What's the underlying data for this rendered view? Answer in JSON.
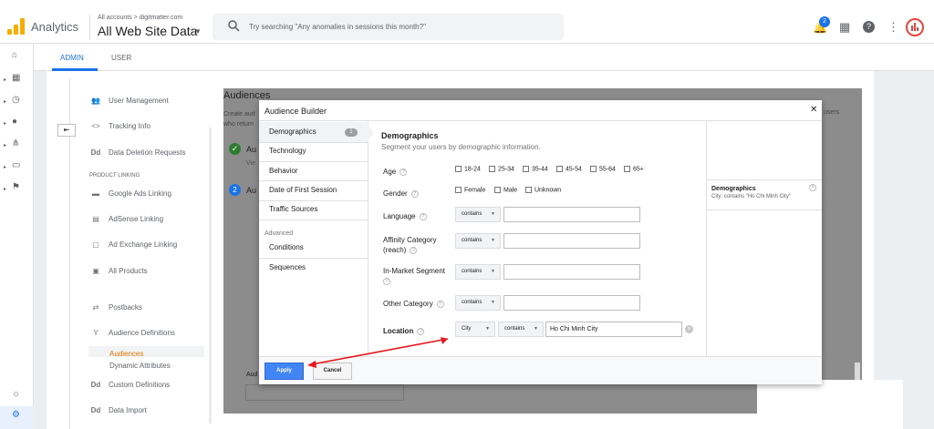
{
  "header": {
    "app_name": "Analytics",
    "account_crumb": "All accounts > digitmatter.com",
    "view_name": "All Web Site Data",
    "search_placeholder": "Try searching \"Any anomalies in sessions this month?\"",
    "notification_count": "2",
    "icons": [
      "notifications-icon",
      "apps-icon",
      "help-icon",
      "more-icon",
      "analytics-logo-icon"
    ]
  },
  "tabs": {
    "admin": "ADMIN",
    "user": "USER"
  },
  "admin_menu": {
    "items": [
      {
        "label": "User Management",
        "icon": "users-icon"
      },
      {
        "label": "Tracking Info",
        "icon": "code-icon"
      },
      {
        "label": "Data Deletion Requests",
        "icon": "dd-icon"
      }
    ],
    "product_linking_heading": "PRODUCT LINKING",
    "linking": [
      {
        "label": "Google Ads Linking",
        "icon": "google-ads-icon"
      },
      {
        "label": "AdSense Linking",
        "icon": "adsense-icon"
      },
      {
        "label": "Ad Exchange Linking",
        "icon": "ad-exchange-icon"
      },
      {
        "label": "All Products",
        "icon": "all-products-icon"
      }
    ],
    "postbacks": "Postbacks",
    "audience_definitions": "Audience Definitions",
    "audiences": "Audiences",
    "dynamic_attributes": "Dynamic Attributes",
    "custom_definitions": "Custom Definitions",
    "data_import": "Data Import"
  },
  "background": {
    "title": "Audiences",
    "desc_line1": "Create aud",
    "desc_line2": "who return",
    "users_text": "users",
    "step1_label": "Au",
    "step1_sub": "Vie",
    "step2_label": "Au",
    "bottom_label": "Aud"
  },
  "dialog": {
    "title": "Audience Builder",
    "categories": [
      {
        "label": "Demographics",
        "count": "1"
      },
      {
        "label": "Technology"
      },
      {
        "label": "Behavior"
      },
      {
        "label": "Date of First Session"
      },
      {
        "label": "Traffic Sources"
      }
    ],
    "advanced_heading": "Advanced",
    "advanced": [
      "Conditions",
      "Sequences"
    ],
    "section_title": "Demographics",
    "section_subtitle": "Segment your users by demographic information.",
    "age_label": "Age",
    "age_options": [
      "18-24",
      "25-34",
      "35-44",
      "45-54",
      "55-64",
      "65+"
    ],
    "gender_label": "Gender",
    "gender_options": [
      "Female",
      "Male",
      "Unknown"
    ],
    "language_label": "Language",
    "affinity_label_1": "Affinity Category",
    "affinity_label_2": "(reach)",
    "in_market_label": "In-Market Segment",
    "other_category_label": "Other Category",
    "location_label": "Location",
    "contains": "contains",
    "city": "City",
    "location_value": "Ho Chi Minh City",
    "summary_title": "Demographics",
    "summary_text": "City: contains \"Ho Chi Minh City\"",
    "apply": "Apply",
    "cancel": "Cancel"
  },
  "colors": {
    "accent": "#1a73e8",
    "apply": "#4285f4",
    "annotation_arrow": "#e8151b",
    "logo": "#f9ab00",
    "success": "#2e7d32"
  }
}
